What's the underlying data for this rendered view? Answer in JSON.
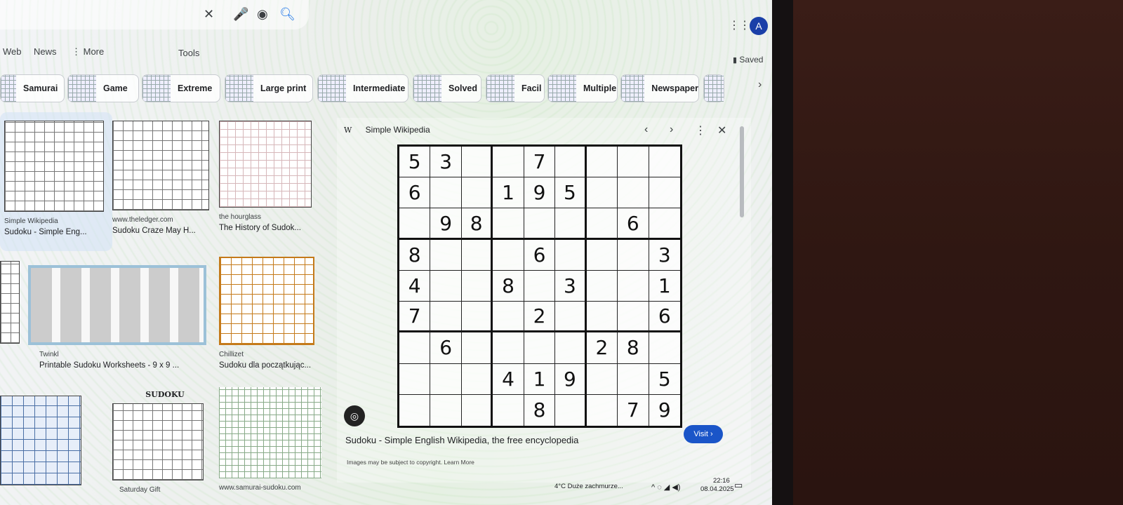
{
  "search": {
    "clear": "✕",
    "mic": "🎤",
    "lens": "◉",
    "search": "🔍"
  },
  "account": {
    "avatar": "A"
  },
  "nav": {
    "web": "Web",
    "news": "News",
    "more": "⋮ More",
    "tools": "Tools",
    "saved": "Saved"
  },
  "chips": [
    {
      "label": "Samurai"
    },
    {
      "label": "Game"
    },
    {
      "label": "Extreme"
    },
    {
      "label": "Large print"
    },
    {
      "label": "Intermediate"
    },
    {
      "label": "Solved"
    },
    {
      "label": "Facil"
    },
    {
      "label": "Multiple"
    },
    {
      "label": "Newspaper"
    }
  ],
  "results": [
    {
      "source": "Simple Wikipedia",
      "title": "Sudoku - Simple Eng..."
    },
    {
      "source": "www.theledger.com",
      "title": "Sudoku Craze May H..."
    },
    {
      "source": "the hourglass",
      "title": "The History of Sudok..."
    },
    {
      "source": "Twinkl",
      "title": "Printable Sudoku Worksheets - 9 x 9 ..."
    },
    {
      "source": "Chillizet",
      "title": "Sudoku dla początkując..."
    },
    {
      "source": "Saturday Gift",
      "title": ""
    },
    {
      "source": "www.samurai-sudoku.com",
      "title": ""
    }
  ],
  "thumb_sudoku_label": "SUDOKU",
  "panel": {
    "source": "Simple Wikipedia",
    "title": "Sudoku - Simple English Wikipedia, the free encyclopedia",
    "visit": "Visit ›",
    "copyright": "Images may be subject to copyright. Learn More",
    "prev": "‹",
    "next": "›",
    "menu": "⋮",
    "close": "✕",
    "board": [
      [
        "5",
        "3",
        "",
        "",
        "7",
        "",
        "",
        "",
        ""
      ],
      [
        "6",
        "",
        "",
        "1",
        "9",
        "5",
        "",
        "",
        ""
      ],
      [
        "",
        "9",
        "8",
        "",
        "",
        "",
        "",
        "6",
        ""
      ],
      [
        "8",
        "",
        "",
        "",
        "6",
        "",
        "",
        "",
        "3"
      ],
      [
        "4",
        "",
        "",
        "8",
        "",
        "3",
        "",
        "",
        "1"
      ],
      [
        "7",
        "",
        "",
        "",
        "2",
        "",
        "",
        "",
        "6"
      ],
      [
        "",
        "6",
        "",
        "",
        "",
        "",
        "2",
        "8",
        ""
      ],
      [
        "",
        "",
        "",
        "4",
        "1",
        "9",
        "",
        "",
        "5"
      ],
      [
        "",
        "",
        "",
        "",
        "8",
        "",
        "",
        "7",
        "9"
      ]
    ]
  },
  "taskbar": {
    "weather": "4°C  Duże zachmurze...",
    "time": "22:16",
    "date": "08.04.2025"
  }
}
